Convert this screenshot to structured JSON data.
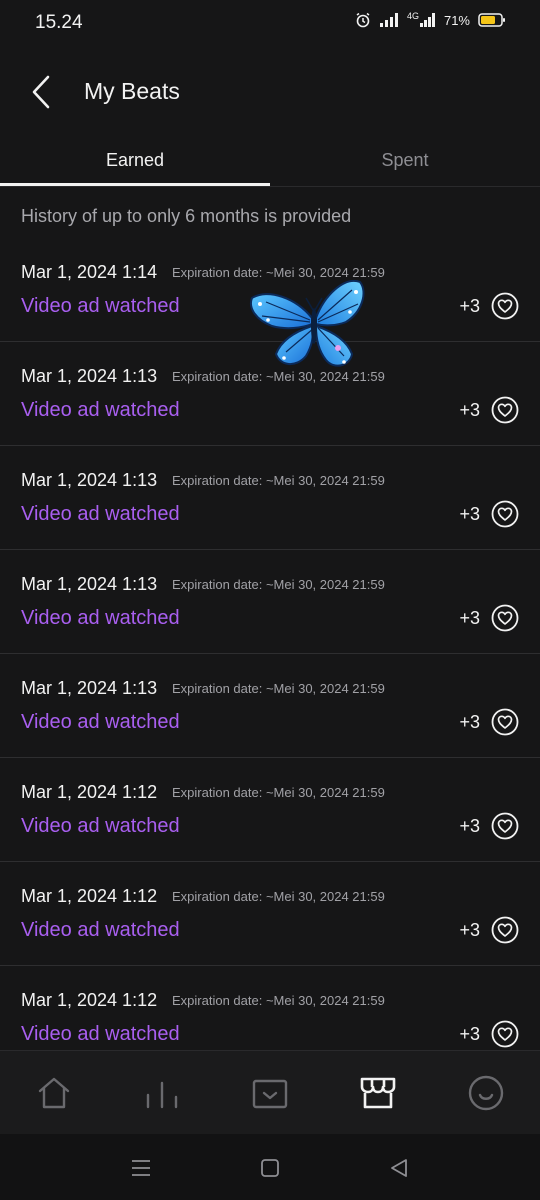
{
  "status_bar": {
    "time": "15.24",
    "network": "4G",
    "battery": "71%",
    "icons": [
      "alarm-icon",
      "signal-icon",
      "signal-4g-icon",
      "battery-icon"
    ]
  },
  "header": {
    "title": "My Beats",
    "back_icon": "chevron-left-icon"
  },
  "tabs": [
    {
      "label": "Earned",
      "active": true
    },
    {
      "label": "Spent",
      "active": false
    }
  ],
  "history_note": "History of up to only 6 months is provided",
  "transactions": [
    {
      "date": "Mar 1, 2024 1:14",
      "expiration": "Expiration date: ~Mei 30, 2024 21:59",
      "description": "Video ad watched",
      "amount": "+3"
    },
    {
      "date": "Mar 1, 2024 1:13",
      "expiration": "Expiration date: ~Mei 30, 2024 21:59",
      "description": "Video ad watched",
      "amount": "+3"
    },
    {
      "date": "Mar 1, 2024 1:13",
      "expiration": "Expiration date: ~Mei 30, 2024 21:59",
      "description": "Video ad watched",
      "amount": "+3"
    },
    {
      "date": "Mar 1, 2024 1:13",
      "expiration": "Expiration date: ~Mei 30, 2024 21:59",
      "description": "Video ad watched",
      "amount": "+3"
    },
    {
      "date": "Mar 1, 2024 1:13",
      "expiration": "Expiration date: ~Mei 30, 2024 21:59",
      "description": "Video ad watched",
      "amount": "+3"
    },
    {
      "date": "Mar 1, 2024 1:12",
      "expiration": "Expiration date: ~Mei 30, 2024 21:59",
      "description": "Video ad watched",
      "amount": "+3"
    },
    {
      "date": "Mar 1, 2024 1:12",
      "expiration": "Expiration date: ~Mei 30, 2024 21:59",
      "description": "Video ad watched",
      "amount": "+3"
    },
    {
      "date": "Mar 1, 2024 1:12",
      "expiration": "Expiration date: ~Mei 30, 2024 21:59",
      "description": "Video ad watched",
      "amount": "+3"
    }
  ],
  "bottom_nav": [
    "home-icon",
    "charts-icon",
    "inbox-icon",
    "store-icon",
    "smiley-icon"
  ],
  "system_nav": [
    "menu-icon",
    "home-square-icon",
    "back-triangle-icon"
  ],
  "colors": {
    "background": "#161617",
    "accent_purple": "#a95ff0",
    "butterfly_blue": "#2aa7f0"
  }
}
